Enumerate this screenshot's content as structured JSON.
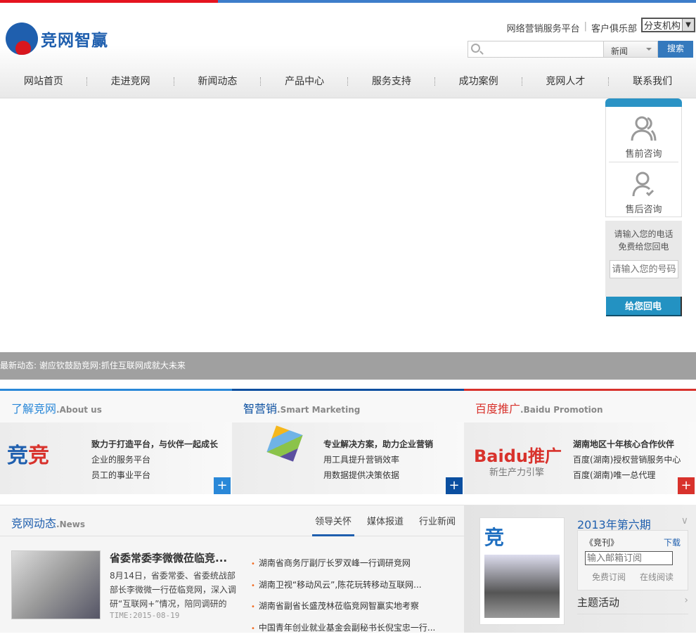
{
  "header": {
    "logo_text": "竞网智赢",
    "links": [
      "网络营销服务平台",
      "客户俱乐部"
    ],
    "branch_select": "分支机构",
    "search_placeholder": "",
    "search_category": "新闻",
    "search_button": "搜索"
  },
  "nav": [
    "网站首页",
    "走进竞网",
    "新闻动态",
    "产品中心",
    "服务支持",
    "成功案例",
    "竞网人才",
    "联系我们"
  ],
  "widget": {
    "presale": "售前咨询",
    "aftersale": "售后咨询",
    "call_line1": "请输入您的电话",
    "call_line2": "免费给您回电",
    "phone_placeholder": "请输入您的号码",
    "call_button": "给您回电"
  },
  "ticker": "最新动态: 谢应钦鼓励竞网:抓住互联网成就大未来",
  "panels": [
    {
      "title": "了解竞网",
      "en": ".About us",
      "color": "#2a88d8",
      "lines": [
        "致力于打造平台，与伙伴一起成长",
        "企业的服务平台",
        "员工的事业平台"
      ],
      "plus": "+"
    },
    {
      "title": "智营销",
      "en": ".Smart Marketing",
      "color": "#0b4fa0",
      "lines": [
        "专业解决方案，助力企业营销",
        "用工具提升营销效率",
        "用数据提供决策依据"
      ],
      "plus": "+"
    },
    {
      "title": "百度推广",
      "en": ".Baidu Promotion",
      "color": "#d8322c",
      "lines": [
        "湖南地区十年核心合作伙伴",
        "百度(湖南)授权营销服务中心",
        "百度(湖南)唯一总代理"
      ],
      "plus": "+",
      "logo": "Baidu推广",
      "logo_sub": "新生产力引擎"
    }
  ],
  "news": {
    "title": "竞网动态",
    "en": ".News",
    "tabs": [
      "领导关怀",
      "媒体报道",
      "行业新闻"
    ],
    "active_tab": 0,
    "featured": {
      "title": "省委常委李微微莅临竞...",
      "desc": "8月14日，省委常委、省委统战部部长李微微一行莅临竞网，深入调研“互联网+”情况，陪同调研的",
      "time": "TIME:2015-08-19"
    },
    "items": [
      "湖南省商务厅副厅长罗双峰一行调研竞网",
      "湖南卫视“移动风云”,陈花玩转移动互联网...",
      "湖南省副省长盛茂林莅临竞网智赢实地考察",
      "中国青年创业就业基金会副秘书长倪宝忠一行..."
    ]
  },
  "magazine": {
    "cover_char": "竞",
    "issue": "2013年第六期",
    "name": "《竞刊》",
    "download": "下载",
    "email_placeholder": "输入邮箱订阅",
    "free_sub": "免费订阅",
    "read_online": "在线阅读",
    "theme": "主题活动"
  }
}
